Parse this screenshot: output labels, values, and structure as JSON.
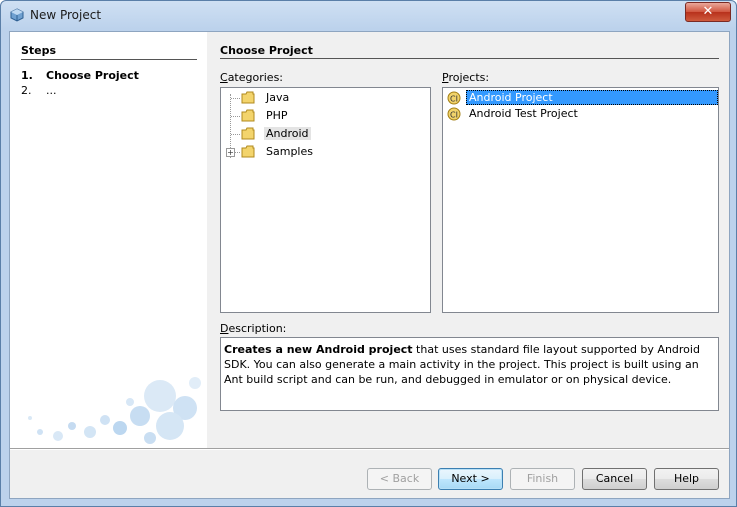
{
  "window": {
    "title": "New Project",
    "close_label": "✕"
  },
  "steps": {
    "title": "Steps",
    "items": [
      {
        "num": "1.",
        "label": "Choose Project",
        "bold": true
      },
      {
        "num": "2.",
        "label": "...",
        "bold": false
      }
    ]
  },
  "content": {
    "title": "Choose Project",
    "categories_label": "Categories:",
    "projects_label": "Projects:",
    "description_label": "Description:"
  },
  "categories": [
    {
      "label": "Java",
      "expandable": false,
      "selected": false
    },
    {
      "label": "PHP",
      "expandable": false,
      "selected": false
    },
    {
      "label": "Android",
      "expandable": false,
      "selected": true
    },
    {
      "label": "Samples",
      "expandable": true,
      "selected": false
    }
  ],
  "projects": [
    {
      "label": "Android Project",
      "selected": true
    },
    {
      "label": "Android Test Project",
      "selected": false
    }
  ],
  "description": {
    "bold": "Creates a new Android project",
    "rest": " that uses standard file layout supported by Android SDK. You can also generate a main activity in the project. This project is built using an Ant build script and can be run, and debugged in emulator or on physical device."
  },
  "buttons": {
    "back": "< Back",
    "next": "Next >",
    "finish": "Finish",
    "cancel": "Cancel",
    "help": "Help"
  },
  "colors": {
    "selection": "#3399ff",
    "title_bar": "#bcd2ec"
  },
  "icons": {
    "window": "netbeans-cube-icon",
    "category": "folder-icon",
    "project": "android-project-icon"
  }
}
